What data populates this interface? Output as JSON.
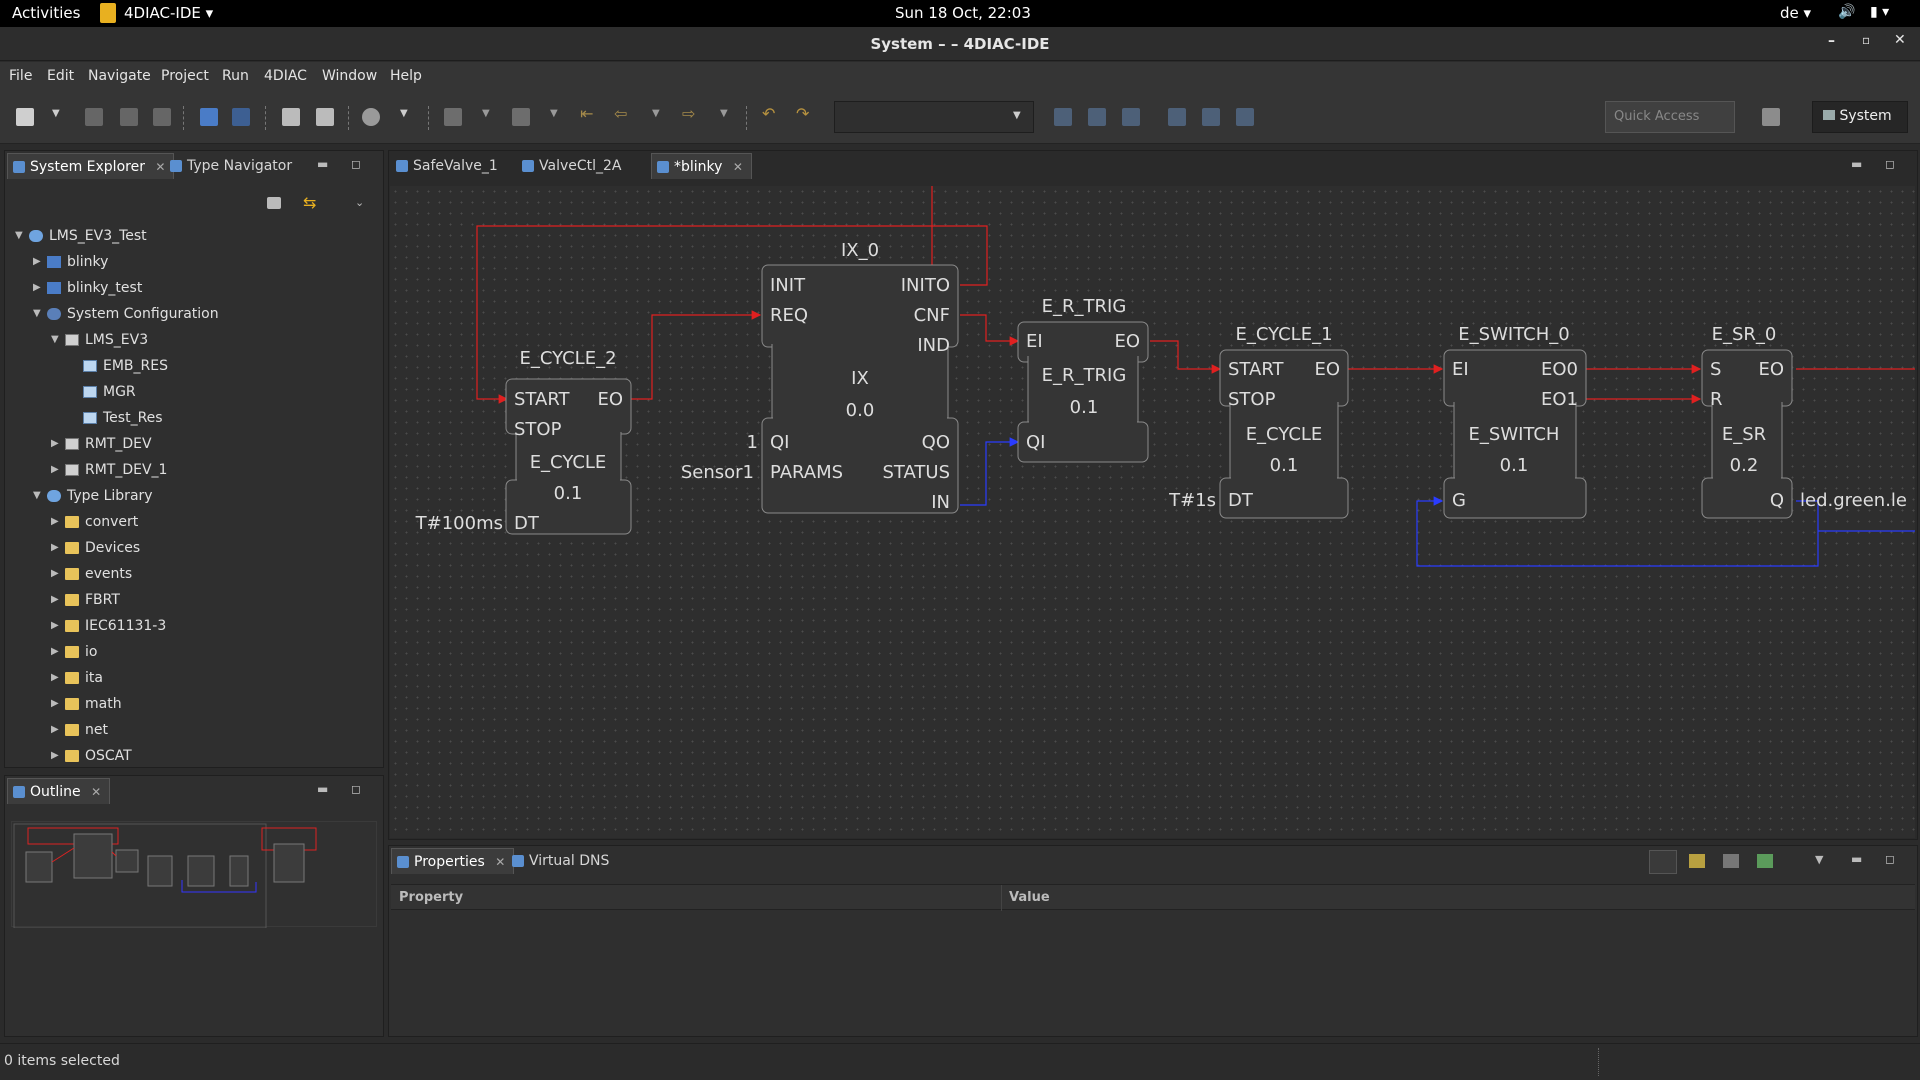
{
  "topbar": {
    "activities": "Activities",
    "app": "4DIAC-IDE",
    "clock": "Sun 18 Oct, 22:03",
    "lang": "de"
  },
  "window": {
    "title": "System – – 4DIAC-IDE"
  },
  "menu": [
    "File",
    "Edit",
    "Navigate",
    "Project",
    "Run",
    "4DIAC",
    "Window",
    "Help"
  ],
  "toolbar": {
    "quick_access_placeholder": "Quick Access",
    "perspective": "System"
  },
  "left_tabs": {
    "system_explorer": "System Explorer",
    "type_navigator": "Type Navigator"
  },
  "tree": [
    {
      "label": "LMS_EV3_Test",
      "level": 0,
      "icon": "system-icon",
      "expanded": true
    },
    {
      "label": "blinky",
      "level": 1,
      "icon": "application-icon",
      "expanded": false
    },
    {
      "label": "blinky_test",
      "level": 1,
      "icon": "application-icon",
      "expanded": false
    },
    {
      "label": "System Configuration",
      "level": 1,
      "icon": "system-configuration-icon",
      "expanded": true
    },
    {
      "label": "LMS_EV3",
      "level": 2,
      "icon": "device-icon",
      "expanded": true
    },
    {
      "label": "EMB_RES",
      "level": 3,
      "icon": "resource-icon",
      "expanded": null
    },
    {
      "label": "MGR",
      "level": 3,
      "icon": "resource-icon",
      "expanded": null
    },
    {
      "label": "Test_Res",
      "level": 3,
      "icon": "resource-icon",
      "expanded": null
    },
    {
      "label": "RMT_DEV",
      "level": 2,
      "icon": "device-icon",
      "expanded": false
    },
    {
      "label": "RMT_DEV_1",
      "level": 2,
      "icon": "device-icon",
      "expanded": false
    },
    {
      "label": "Type Library",
      "level": 1,
      "icon": "type-library-icon",
      "expanded": true
    },
    {
      "label": "convert",
      "level": 2,
      "icon": "folder-icon",
      "expanded": false
    },
    {
      "label": "Devices",
      "level": 2,
      "icon": "folder-icon",
      "expanded": false
    },
    {
      "label": "events",
      "level": 2,
      "icon": "folder-icon",
      "expanded": false
    },
    {
      "label": "FBRT",
      "level": 2,
      "icon": "folder-icon",
      "expanded": false
    },
    {
      "label": "IEC61131-3",
      "level": 2,
      "icon": "folder-icon",
      "expanded": false
    },
    {
      "label": "io",
      "level": 2,
      "icon": "folder-icon",
      "expanded": false
    },
    {
      "label": "ita",
      "level": 2,
      "icon": "folder-icon",
      "expanded": false
    },
    {
      "label": "math",
      "level": 2,
      "icon": "folder-icon",
      "expanded": false
    },
    {
      "label": "net",
      "level": 2,
      "icon": "folder-icon",
      "expanded": false
    },
    {
      "label": "OSCAT",
      "level": 2,
      "icon": "folder-icon",
      "expanded": false
    }
  ],
  "outline": {
    "title": "Outline"
  },
  "editor_tabs": [
    {
      "label": "SafeValve_1",
      "active": false,
      "closable": false
    },
    {
      "label": "ValveCtl_2A",
      "active": false,
      "closable": false
    },
    {
      "label": "*blinky",
      "active": true,
      "closable": true
    }
  ],
  "function_blocks": {
    "e_cycle_2": {
      "name": "E_CYCLE_2",
      "type": "E_CYCLE",
      "version": "0.1",
      "ev_in": [
        "START",
        "STOP"
      ],
      "ev_out": [
        "EO"
      ],
      "data_in": [
        "DT"
      ],
      "dt_value": "T#100ms"
    },
    "ix_0": {
      "name": "IX_0",
      "type": "IX",
      "version": "0.0",
      "ev_in": [
        "INIT",
        "REQ"
      ],
      "ev_out": [
        "INITO",
        "CNF",
        "IND"
      ],
      "data_in": [
        "QI",
        "PARAMS"
      ],
      "data_out": [
        "QO",
        "STATUS",
        "IN"
      ],
      "qi_value": "1",
      "params_value": "Sensor1"
    },
    "e_r_trig": {
      "name": "E_R_TRIG",
      "type": "E_R_TRIG",
      "version": "0.1",
      "ev_in": [
        "EI"
      ],
      "ev_out": [
        "EO"
      ],
      "data_in": [
        "QI"
      ]
    },
    "e_cycle_1": {
      "name": "E_CYCLE_1",
      "type": "E_CYCLE",
      "version": "0.1",
      "ev_in": [
        "START",
        "STOP"
      ],
      "ev_out": [
        "EO"
      ],
      "data_in": [
        "DT"
      ],
      "dt_value": "T#1s"
    },
    "e_switch_0": {
      "name": "E_SWITCH_0",
      "type": "E_SWITCH",
      "version": "0.1",
      "ev_in": [
        "EI"
      ],
      "ev_out": [
        "EO0",
        "EO1"
      ],
      "data_in": [
        "G"
      ]
    },
    "e_sr_0": {
      "name": "E_SR_0",
      "type": "E_SR",
      "version": "0.2",
      "ev_in": [
        "S",
        "R"
      ],
      "ev_out": [
        "EO"
      ],
      "data_out": [
        "Q"
      ],
      "q_target": "led.green.le"
    }
  },
  "bottom_tabs": {
    "properties": "Properties",
    "virtual_dns": "Virtual DNS"
  },
  "properties_table": {
    "columns": [
      "Property",
      "Value"
    ]
  },
  "status": {
    "text": "0 items selected"
  },
  "colors": {
    "event": "#e02020",
    "data": "#2a3cff",
    "background": "#2e2e2e",
    "fb_fill": "#353535"
  }
}
